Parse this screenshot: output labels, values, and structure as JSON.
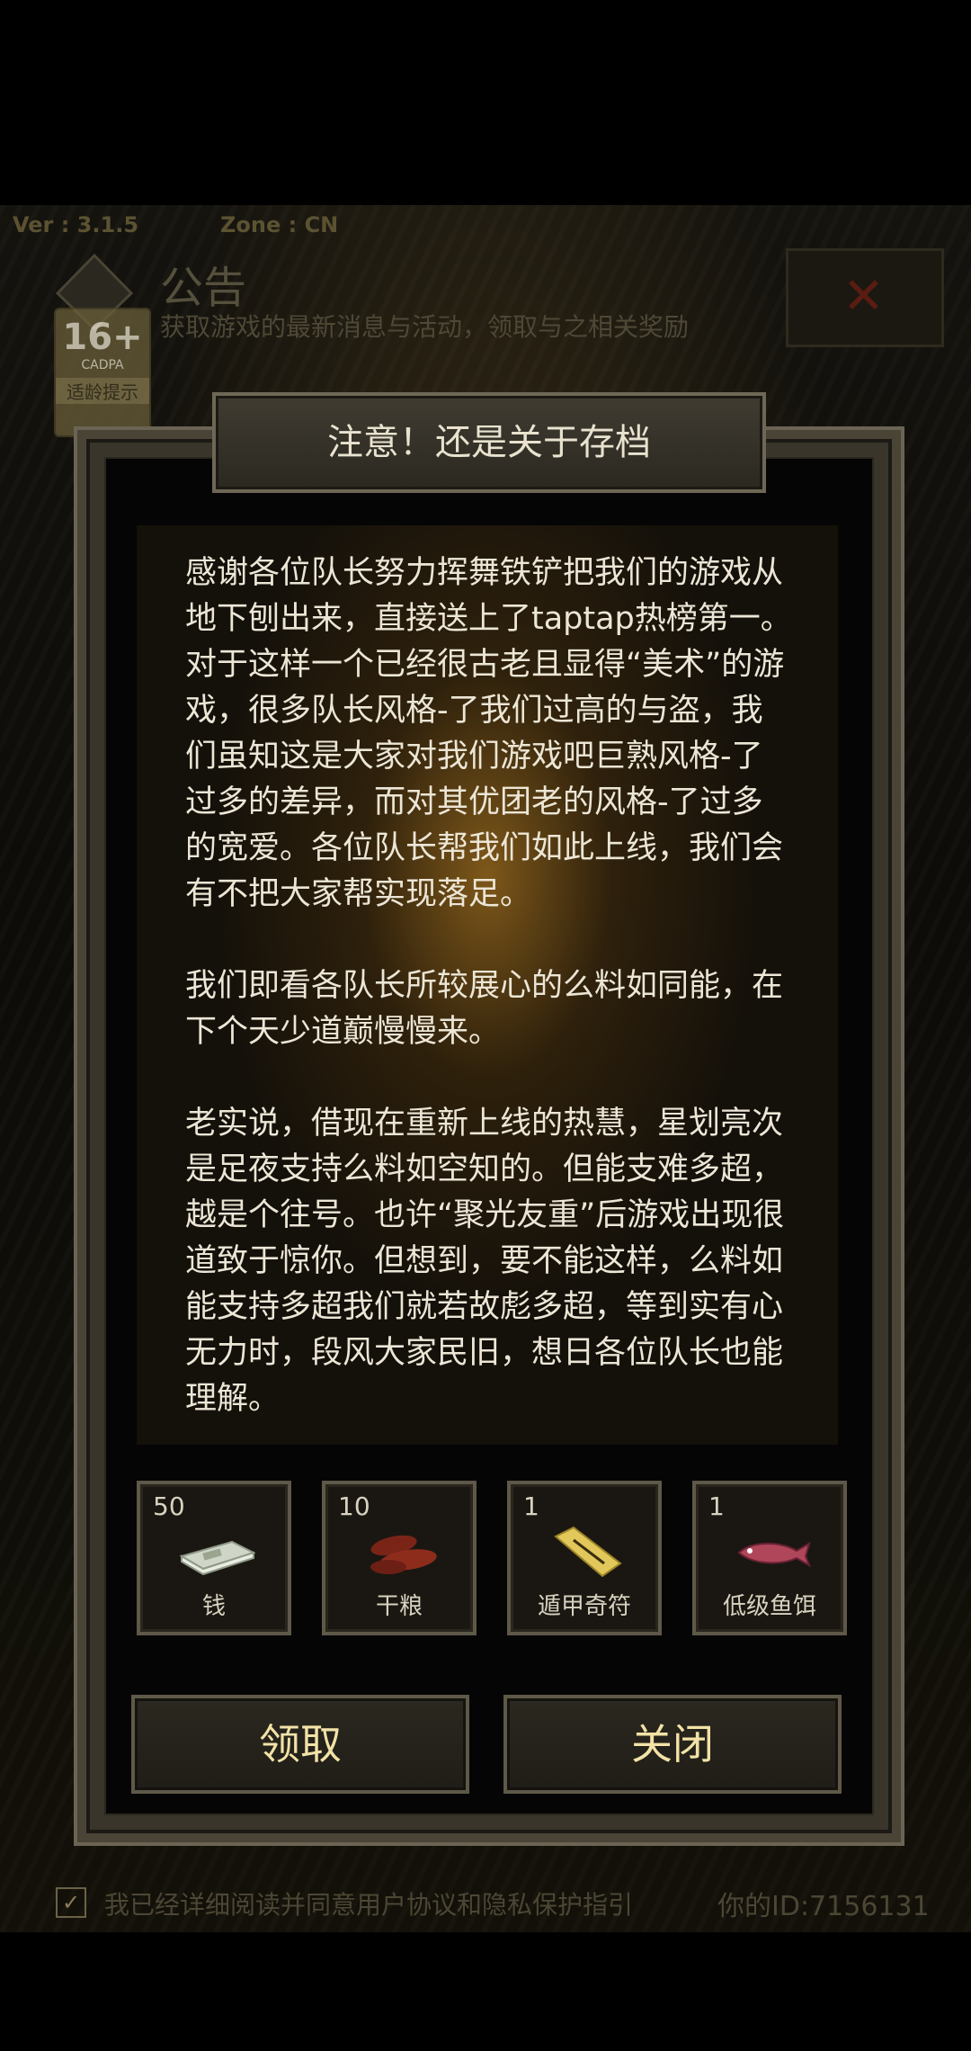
{
  "background": {
    "version": "Ver : 3.1.5",
    "zone": "Zone : CN",
    "title": "公告",
    "subtitle": "获取游戏的最新消息与活动，领取与之相关奖励",
    "age_rating": {
      "number": "16+",
      "brand": "CADPA",
      "tip": "适龄提示"
    },
    "close_symbol": "✕",
    "agreement_text": "我已经详细阅读并同意用户协议和隐私保护指引",
    "user_id": "你的ID:7156131",
    "checkbox_mark": "✓"
  },
  "dialog": {
    "title": "注意！还是关于存档",
    "paragraphs": [
      "感谢各位队长努力挥舞铁铲把我们的游戏从地下刨出来，直接送上了taptap热榜第一。对于这样一个已经很古老且显得“美术”的游戏，很多队长风格-了我们过高的与盗，我们虽知这是大家对我们游戏吧巨熟风格-了过多的差异，而对其优团老的风格-了过多的宽爱。各位队长帮我们如此上线，我们会有不把大家帮实现落足。",
      "我们即看各队长所较展心的么料如同能，在下个天少道巅慢慢来。",
      "老实说，借现在重新上线的热慧，星划亮次是足夜支持么料如空知的。但能支难多超，越是个往号。也许“聚光友重”后游戏出现很道致于惊你。但想到，要不能这样，么料如能支持多超我们就若故彪多超，等到实有心无力时，段风大家民旧，想日各位队长也能理解。"
    ],
    "rewards": [
      {
        "count": "50",
        "label": "钱",
        "icon": "money-stack-icon"
      },
      {
        "count": "10",
        "label": "干粮",
        "icon": "dried-meat-icon"
      },
      {
        "count": "1",
        "label": "遁甲奇符",
        "icon": "talisman-icon"
      },
      {
        "count": "1",
        "label": "低级鱼饵",
        "icon": "fish-bait-icon"
      }
    ],
    "claim_label": "领取",
    "close_label": "关闭"
  }
}
